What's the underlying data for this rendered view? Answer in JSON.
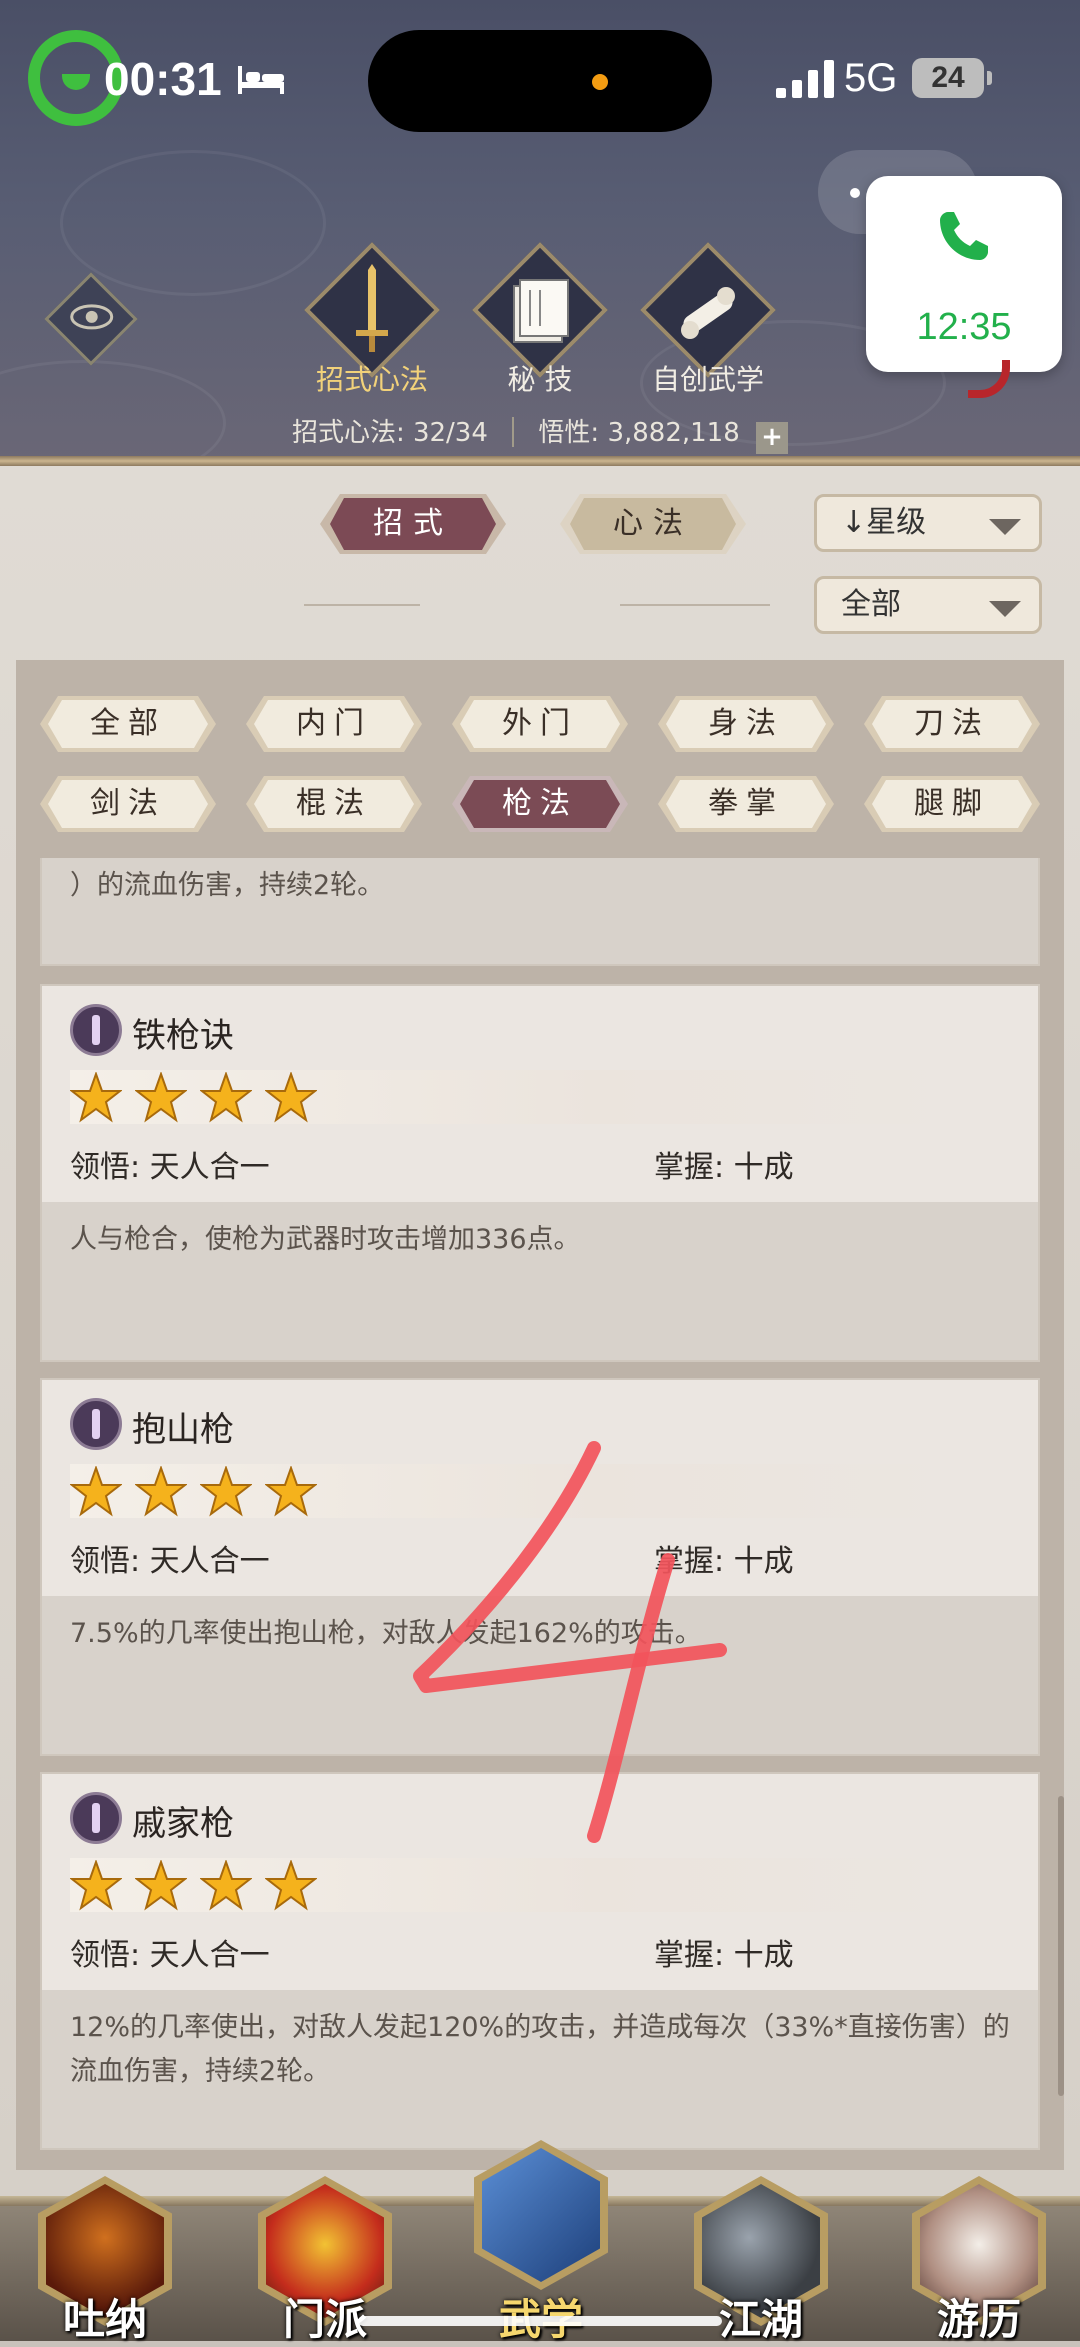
{
  "status_bar": {
    "time": "00:31",
    "network": "5G",
    "battery": "24"
  },
  "call_widget": {
    "time": "12:35"
  },
  "top_tabs": [
    {
      "label": "招式心法",
      "active": true
    },
    {
      "label": "秘 技",
      "active": false
    },
    {
      "label": "自创武学",
      "active": false
    }
  ],
  "stats": {
    "moves_label": "招式心法: 32/34",
    "insight_label": "悟性: 3,882,118",
    "plus": "+"
  },
  "main_tabs": [
    {
      "label": "招式",
      "active": true
    },
    {
      "label": "心法",
      "active": false
    }
  ],
  "sort_dropdown": {
    "arrow": "↓",
    "value": "星级"
  },
  "filter_dropdown": {
    "value": "全部"
  },
  "categories": [
    {
      "label": "全部",
      "active": false
    },
    {
      "label": "内门",
      "active": false
    },
    {
      "label": "外门",
      "active": false
    },
    {
      "label": "身法",
      "active": false
    },
    {
      "label": "刀法",
      "active": false
    },
    {
      "label": "剑法",
      "active": false
    },
    {
      "label": "棍法",
      "active": false
    },
    {
      "label": "枪法",
      "active": true
    },
    {
      "label": "拳掌",
      "active": false
    },
    {
      "label": "腿脚",
      "active": false
    }
  ],
  "skills": [
    {
      "name": "",
      "stars": 0,
      "comprehension_label": "",
      "mastery_label": "",
      "description": "）的流血伤害，持续2轮。"
    },
    {
      "name": "铁枪诀",
      "stars": 4,
      "comprehension_label": "领悟:  天人合一",
      "mastery_label": "掌握:  十成",
      "description": "人与枪合，使枪为武器时攻击增加336点。"
    },
    {
      "name": "抱山枪",
      "stars": 4,
      "comprehension_label": "领悟:  天人合一",
      "mastery_label": "掌握:  十成",
      "description": "7.5%的几率使出抱山枪，对敌人发起162%的攻击。"
    },
    {
      "name": "戚家枪",
      "stars": 4,
      "comprehension_label": "领悟:  天人合一",
      "mastery_label": "掌握:  十成",
      "description": "12%的几率使出，对敌人发起120%的攻击，并造成每次（33%*直接伤害）的流血伤害，持续2轮。"
    }
  ],
  "bottom_nav": [
    {
      "label": "吐纳",
      "active": false
    },
    {
      "label": "门派",
      "active": false
    },
    {
      "label": "武学",
      "active": true
    },
    {
      "label": "江湖",
      "active": false
    },
    {
      "label": "游历",
      "active": false
    }
  ],
  "annotation": "4",
  "colors": {
    "active_tab": "#7c4a55",
    "star": "#f5b21c",
    "nav_active_label": "#f6d76e",
    "call_green": "#22b04b",
    "scribble": "#f2545b"
  }
}
